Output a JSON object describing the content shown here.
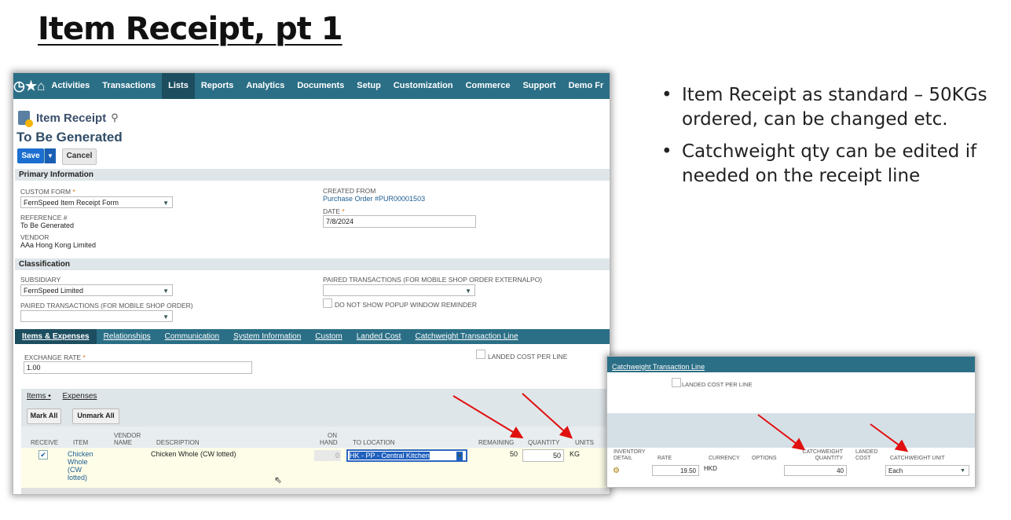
{
  "slide": {
    "title": "Item Receipt, pt 1",
    "bullets": [
      "Item Receipt as standard – 50KGs ordered, can be changed etc.",
      "Catchweight qty can be edited if needed on the receipt line"
    ]
  },
  "nav": {
    "items": [
      "Activities",
      "Transactions",
      "Lists",
      "Reports",
      "Analytics",
      "Documents",
      "Setup",
      "Customization",
      "Commerce",
      "Support",
      "Demo Fr"
    ],
    "active": "Lists"
  },
  "record": {
    "type": "Item Receipt",
    "title": "To Be Generated",
    "save_label": "Save",
    "cancel_label": "Cancel"
  },
  "primary": {
    "section": "Primary Information",
    "custom_form_label": "CUSTOM FORM",
    "custom_form_value": "FernSpeed Item Receipt Form",
    "reference_label": "REFERENCE #",
    "reference_value": "To Be Generated",
    "vendor_label": "VENDOR",
    "vendor_value": "AAa Hong Kong Limited",
    "created_from_label": "CREATED FROM",
    "created_from_value": "Purchase Order #PUR00001503",
    "date_label": "DATE",
    "date_value": "7/8/2024"
  },
  "classification": {
    "section": "Classification",
    "subsidiary_label": "SUBSIDIARY",
    "subsidiary_value": "FernSpeed Limited",
    "paired_label": "PAIRED TRANSACTIONS (FOR MOBILE SHOP ORDER)",
    "paired_ext_label": "PAIRED TRANSACTIONS (FOR MOBILE SHOP ORDER EXTERNALPO)",
    "no_popup_label": "DO NOT SHOW POPUP WINDOW REMINDER"
  },
  "tabs": [
    "Items & Expenses",
    "Relationships",
    "Communication",
    "System Information",
    "Custom",
    "Landed Cost",
    "Catchweight Transaction Line"
  ],
  "items_expenses": {
    "exchange_rate_label": "EXCHANGE RATE",
    "exchange_rate_value": "1.00",
    "landed_cost_label": "LANDED COST PER LINE",
    "subtabs": [
      "Items •",
      "Expenses"
    ],
    "mark_all": "Mark All",
    "unmark_all": "Unmark All",
    "columns": [
      "RECEIVE",
      "ITEM",
      "VENDOR NAME",
      "DESCRIPTION",
      "ON HAND",
      "TO LOCATION",
      "REMAINING",
      "QUANTITY",
      "UNITS"
    ],
    "row": {
      "receive": "✔",
      "item": "Chicken Whole (CW lotted)",
      "description": "Chicken Whole (CW lotted)",
      "on_hand": "0",
      "to_location": "HK - PP - Central Kitchen",
      "remaining": "50",
      "quantity": "50",
      "units": "KG"
    }
  },
  "catchweight": {
    "header": "Catchweight Transaction Line",
    "landed_cost_label": "LANDED COST PER LINE",
    "columns": [
      "INVENTORY DETAIL",
      "RATE",
      "CURRENCY",
      "OPTIONS",
      "CATCHWEIGHT QUANTITY",
      "LANDED COST",
      "CATCHWEIGHT UNIT"
    ],
    "rate": "19.50",
    "currency": "HKD",
    "cw_quantity": "40",
    "cw_unit": "Each"
  },
  "colors": {
    "nav": "#2b6f86",
    "save": "#1c6fd1",
    "arrow": "#e01010"
  }
}
